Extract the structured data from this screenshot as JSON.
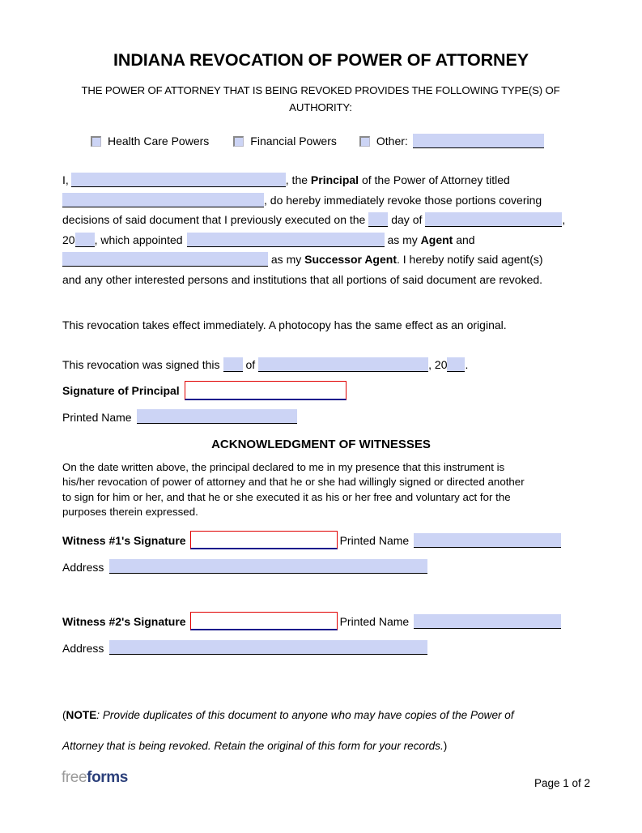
{
  "document": {
    "title": "INDIANA REVOCATION OF POWER OF ATTORNEY",
    "subtitle": "THE POWER OF ATTORNEY THAT IS BEING REVOKED PROVIDES THE FOLLOWING TYPE(S) OF AUTHORITY:"
  },
  "authority_types": {
    "options": [
      {
        "label": "Health Care Powers",
        "checked": false
      },
      {
        "label": "Financial Powers",
        "checked": false
      },
      {
        "label": "Other:",
        "checked": false
      }
    ],
    "other_value": ""
  },
  "body": {
    "l1_a": "I,",
    "l1_b": ", the",
    "l1_bold": "Principal",
    "l1_c": "of the Power of Attorney titled",
    "l2_b": ", do hereby immediately revoke those portions covering",
    "l3_a": "decisions of said document that I previously executed on the",
    "l3_b": "day of",
    "l3_c": ",",
    "l4_a": "20",
    "l4_b": ", which appointed",
    "l4_c": "as my",
    "l4_bold": "Agent",
    "l4_d": "and",
    "l5_a": "as my",
    "l5_bold": "Successor Agent",
    "l5_b": ". I hereby notify said agent(s)",
    "l6": "and any other interested persons and institutions that all portions of said document are revoked.",
    "principal_name_value": "",
    "poa_title_value": "",
    "day_value": "",
    "month_value": "",
    "year_value": "",
    "agent_value": "",
    "successor_agent_value": ""
  },
  "statements": {
    "immediate_effect": "This revocation takes effect immediately. A photocopy has the same effect as an original.",
    "signed_a": "This revocation was signed this",
    "signed_b": "of",
    "signed_c": ", 20",
    "signed_d": ".",
    "signed_day_value": "",
    "signed_month_value": "",
    "signed_year_value": ""
  },
  "principal_signature": {
    "signature_label": "Signature of Principal",
    "signature_value": "",
    "printed_name_label": "Printed Name",
    "printed_name_value": ""
  },
  "witnesses": {
    "heading": "ACKNOWLEDGMENT OF WITNESSES",
    "paragraph": "On the date written above, the principal declared to me in my presence that this instrument is his/her revocation of power of attorney and that he or she had willingly signed or directed another to sign for him or her, and that he or she executed it as his or her free and voluntary act for the purposes therein expressed.",
    "printed_name_label": "Printed Name",
    "address_label": "Address",
    "entries": [
      {
        "signature_label": "Witness #1's Signature",
        "signature_value": "",
        "printed_name_value": "",
        "address_value": ""
      },
      {
        "signature_label": "Witness #2's Signature",
        "signature_value": "",
        "printed_name_value": "",
        "address_value": ""
      }
    ]
  },
  "note": {
    "open_paren": "(",
    "label": "NOTE",
    "line1": ": Provide duplicates of this document to anyone who may have copies of the Power of",
    "line2": "Attorney that is being revoked. Retain the original of this form for your records.",
    "close_paren": ")"
  },
  "footer": {
    "logo_part1": "free",
    "logo_part2": "forms",
    "page_number": "Page 1 of 2"
  },
  "colors": {
    "field_fill": "#ccd4f5",
    "signature_border": "#e00000",
    "signature_underline": "#1a1a8c",
    "logo_gray": "#9a9a9a",
    "logo_navy": "#2b3f7a"
  }
}
